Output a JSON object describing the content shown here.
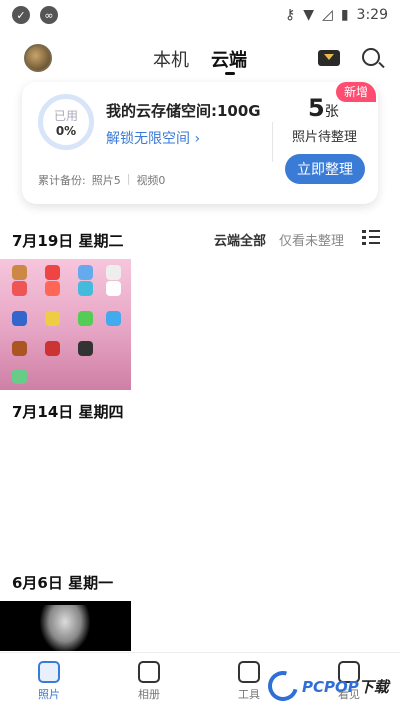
{
  "status_bar": {
    "time": "3:29"
  },
  "header": {
    "tabs": [
      "本机",
      "云端"
    ],
    "active_tab": "云端"
  },
  "storage_card": {
    "ring_label": "已用",
    "ring_percent": "0%",
    "title": "我的云存储空间:100G",
    "unlock_link": "解锁无限空间 ›",
    "summary_backup": "累计备份:",
    "summary_photos": "照片5",
    "summary_sep": "|",
    "summary_videos": "视频0",
    "badge": "新增",
    "pending_count": "5",
    "pending_unit": "张",
    "pending_label": "照片待整理",
    "organize_button": "立即整理"
  },
  "filters": {
    "all": "云端全部",
    "unorganized": "仅看未整理"
  },
  "sections": [
    {
      "date": "7月19日 星期二"
    },
    {
      "date": "7月14日 星期四"
    },
    {
      "date": "6月6日 星期一"
    }
  ],
  "bottom_nav": [
    {
      "label": "照片",
      "icon": "photo-icon"
    },
    {
      "label": "相册",
      "icon": "album-icon"
    },
    {
      "label": "工具",
      "icon": "toolbox-icon"
    },
    {
      "label": "看见",
      "icon": "eye-icon"
    }
  ],
  "watermark": {
    "brand": "PCPOP",
    "suffix": "下载"
  },
  "colors": {
    "accent": "#3a7bd5",
    "badge": "#ff4d72"
  }
}
